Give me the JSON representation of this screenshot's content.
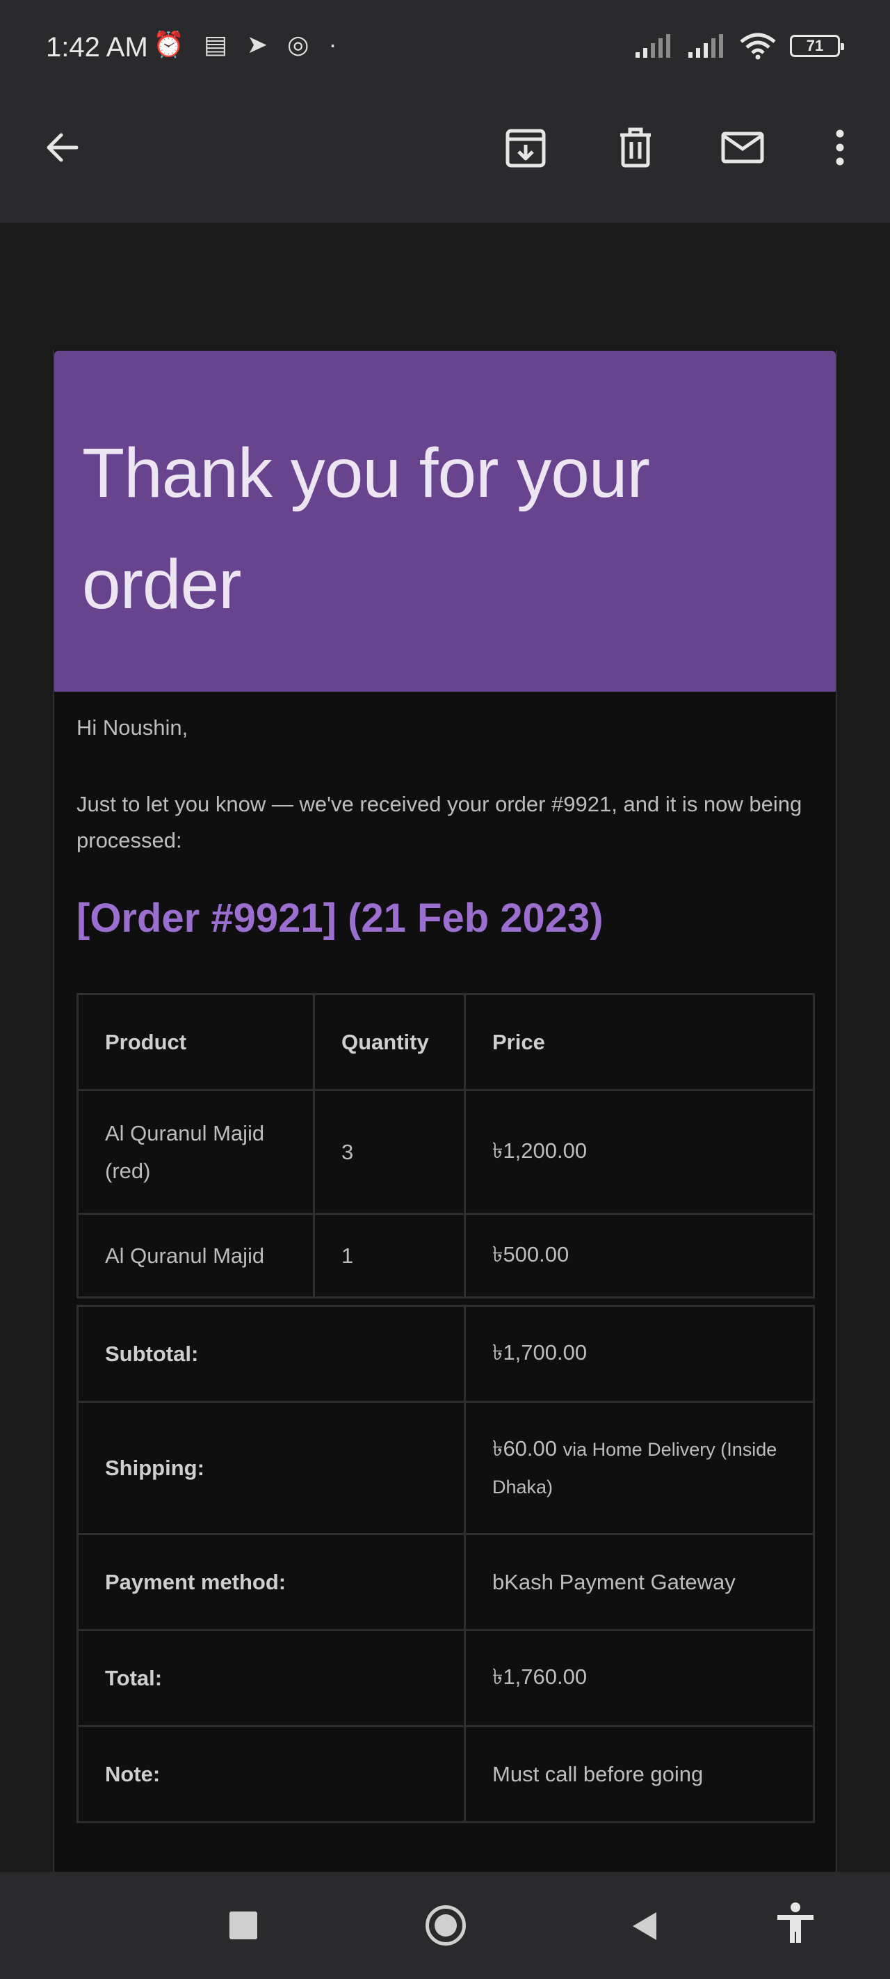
{
  "status_bar": {
    "time": "1:42 AM",
    "battery": "71"
  },
  "app_bar": {
    "icons": [
      "back-arrow-icon",
      "archive-icon",
      "delete-icon",
      "mark-unread-icon",
      "more-vert-icon"
    ]
  },
  "email": {
    "header_title": "Thank you for your order",
    "greeting": "Hi Noushin,",
    "intro": "Just to let you know — we've received your order #9921, and it is now being processed:",
    "order_heading": "[Order #9921] (21 Feb 2023)",
    "accent_color": "#68448f",
    "heading_color": "#9b6fd0",
    "table": {
      "headers": [
        "Product",
        "Quantity",
        "Price"
      ],
      "rows": [
        {
          "product": "Al Quranul Majid (red)",
          "quantity": "3",
          "price": "৳1,200.00"
        },
        {
          "product": "Al Quranul Majid",
          "quantity": "1",
          "price": "৳500.00"
        }
      ]
    },
    "totals": {
      "subtotal_label": "Subtotal:",
      "subtotal_value": "৳1,700.00",
      "shipping_label": "Shipping:",
      "shipping_price": "৳60.00",
      "shipping_method": "via Home Delivery (Inside Dhaka)",
      "payment_label": "Payment method:",
      "payment_value": "bKash Payment Gateway",
      "total_label": "Total:",
      "total_value": "৳1,760.00",
      "note_label": "Note:",
      "note_value": "Must call before going"
    }
  }
}
